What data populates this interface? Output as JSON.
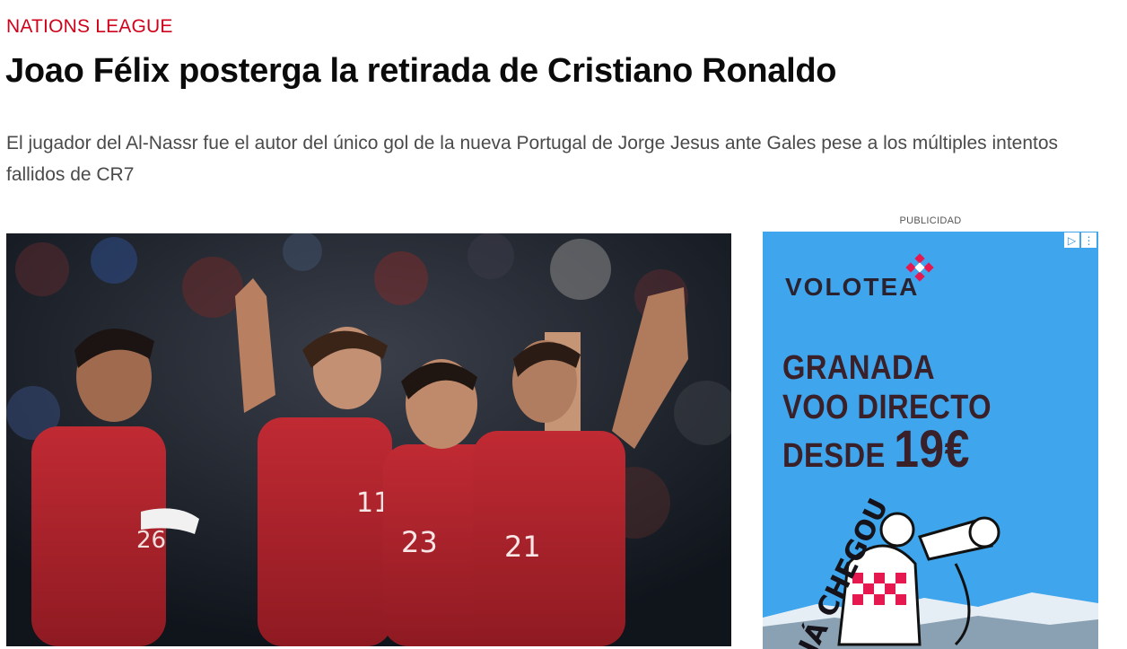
{
  "article": {
    "section": "NATIONS LEAGUE",
    "title": "Joao Félix posterga la retirada de Cristiano Ronaldo",
    "subtitle": "El jugador del Al-Nassr fue el autor del único gol de la nueva Portugal de Jorge Jesus ante Gales pese a los múltiples intentos fallidos de CR7",
    "photo": {
      "jersey_numbers": [
        "26",
        "11",
        "23",
        "21"
      ]
    }
  },
  "ad": {
    "label": "PUBLICIDAD",
    "brand": "VOLOTEA",
    "line1": "GRANADA",
    "line2": "VOO DIRECTO",
    "line3_prefix": "DESDE",
    "price": "19€",
    "tagline": "JÁ CHEGOU",
    "controls": [
      "adchoices-icon",
      "more-options-icon"
    ],
    "colors": {
      "background": "#3fa5ec",
      "accent": "#e5194f",
      "text": "#3a2028"
    }
  },
  "colors": {
    "kicker": "#d0021b"
  }
}
